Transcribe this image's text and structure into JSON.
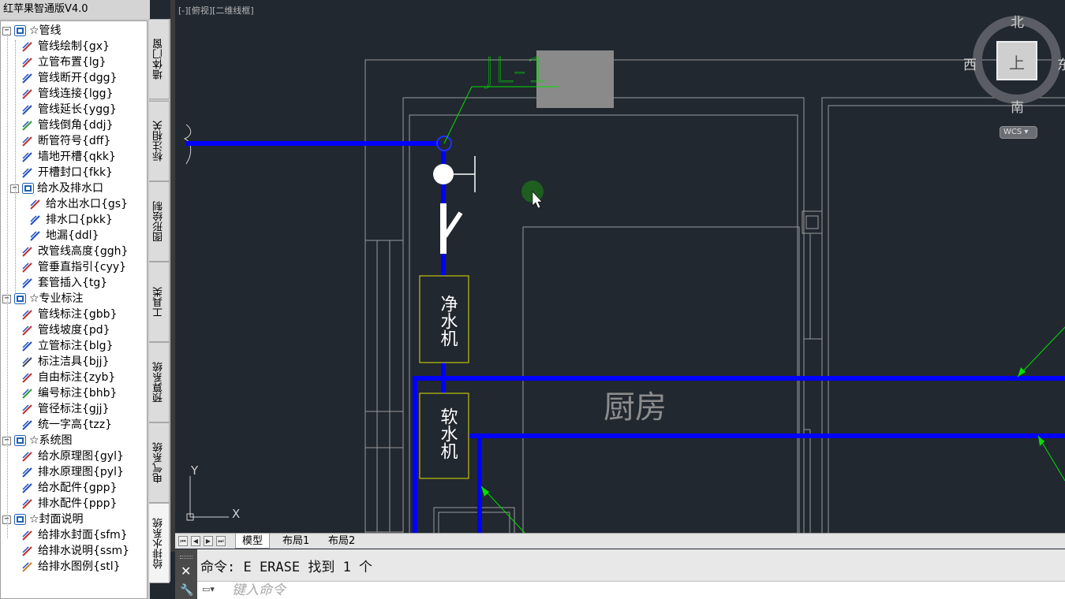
{
  "app": {
    "palette_title": "红苹果智通版V4.0",
    "view_label": "[-][俯视][二维线框]"
  },
  "tree": [
    {
      "level": 0,
      "expand": "−",
      "label": "☆管线",
      "icon": "folder-icon"
    },
    {
      "level": 1,
      "label": "管线绘制{gx}",
      "icon": "draw-pipe-icon",
      "color": "#c03030"
    },
    {
      "level": 1,
      "label": "立管布置{lg}",
      "icon": "riser-icon",
      "color": "#c03030"
    },
    {
      "level": 1,
      "label": "管线断开{dgg}",
      "icon": "break-pipe-icon",
      "color": "#2050c0"
    },
    {
      "level": 1,
      "label": "管线连接{lgg}",
      "icon": "connect-pipe-icon",
      "color": "#c03030"
    },
    {
      "level": 1,
      "label": "管线延长{ygg}",
      "icon": "extend-pipe-icon",
      "color": "#2050c0"
    },
    {
      "level": 1,
      "label": "管线倒角{ddj}",
      "icon": "chamfer-icon",
      "color": "#30a030"
    },
    {
      "level": 1,
      "label": "断管符号{dff}",
      "icon": "break-symbol-icon",
      "color": "#c03030"
    },
    {
      "level": 1,
      "label": "墙地开槽{qkk}",
      "icon": "slot-icon",
      "color": "#2050c0"
    },
    {
      "level": 1,
      "label": "开槽封口{fkk}",
      "icon": "seal-icon",
      "color": "#2050c0"
    },
    {
      "level": 1,
      "expand": "−",
      "label": "给水及排水口",
      "icon": "folder-icon"
    },
    {
      "level": 2,
      "label": "给水出水口{gs}",
      "icon": "water-outlet-icon",
      "color": "#c03030"
    },
    {
      "level": 2,
      "label": "排水口{pkk}",
      "icon": "drain-icon",
      "color": "#2050c0"
    },
    {
      "level": 2,
      "label": "地漏{ddl}",
      "icon": "floor-drain-icon",
      "color": "#2050c0"
    },
    {
      "level": 1,
      "label": "改管线高度{ggh}",
      "icon": "height-icon",
      "color": "#c03030"
    },
    {
      "level": 1,
      "label": "管垂直指引{cyy}",
      "icon": "vertical-lead-icon",
      "color": "#c03030"
    },
    {
      "level": 1,
      "label": "套管插入{tg}",
      "icon": "sleeve-icon",
      "color": "#2050c0"
    },
    {
      "level": 0,
      "expand": "−",
      "label": "☆专业标注",
      "icon": "folder-icon"
    },
    {
      "level": 1,
      "label": "管线标注{gbb}",
      "icon": "pipe-label-icon",
      "color": "#c03030"
    },
    {
      "level": 1,
      "label": "管线坡度{pd}",
      "icon": "slope-icon",
      "color": "#c03030"
    },
    {
      "level": 1,
      "label": "立管标注{blg}",
      "icon": "riser-label-icon",
      "color": "#2050c0"
    },
    {
      "level": 1,
      "label": "标注洁具{bjj}",
      "icon": "fixture-label-icon",
      "color": "#444444"
    },
    {
      "level": 1,
      "label": "自由标注{zyb}",
      "icon": "free-label-icon",
      "color": "#c03030"
    },
    {
      "level": 1,
      "label": "编号标注{bhb}",
      "icon": "number-label-icon",
      "color": "#30a030"
    },
    {
      "level": 1,
      "label": "管径标注{gjj}",
      "icon": "diameter-label-icon",
      "color": "#c03030"
    },
    {
      "level": 1,
      "label": "统一字高{tzz}",
      "icon": "text-height-icon",
      "color": "#2050c0"
    },
    {
      "level": 0,
      "expand": "−",
      "label": "☆系统图",
      "icon": "folder-icon"
    },
    {
      "level": 1,
      "label": "给水原理图{gyl}",
      "icon": "supply-diagram-icon",
      "color": "#c03030"
    },
    {
      "level": 1,
      "label": "排水原理图{pyl}",
      "icon": "drain-diagram-icon",
      "color": "#2050c0"
    },
    {
      "level": 1,
      "label": "给水配件{gpp}",
      "icon": "supply-fitting-icon",
      "color": "#2050c0"
    },
    {
      "level": 1,
      "label": "排水配件{ppp}",
      "icon": "drain-fitting-icon",
      "color": "#c03030"
    },
    {
      "level": 0,
      "expand": "−",
      "label": "☆封面说明",
      "icon": "folder-icon"
    },
    {
      "level": 1,
      "label": "给排水封面{sfm}",
      "icon": "cover-icon",
      "color": "#c03030"
    },
    {
      "level": 1,
      "label": "给排水说明{ssm}",
      "icon": "notes-icon",
      "color": "#c03030"
    },
    {
      "level": 1,
      "label": "给排水图例{stl}",
      "icon": "legend-icon",
      "color": "#d08020"
    }
  ],
  "vtabs": [
    "墙体门窗",
    "标注相关",
    "图形绘制",
    "工具类",
    "预算系统",
    "电气系统",
    "给排水系统"
  ],
  "layout_tabs": [
    "模型",
    "布局1",
    "布局2"
  ],
  "drawing": {
    "riser_label": "JL-1",
    "room_name": "厨房",
    "device1": "净水机",
    "device2": "软水机",
    "ucs_x": "X",
    "ucs_y": "Y"
  },
  "viewcube": {
    "north": "北",
    "south": "南",
    "east": "东",
    "west": "西",
    "top": "上",
    "wcs": "WCS"
  },
  "command": {
    "history": "命令: E ERASE 找到 1 个",
    "placeholder": "键入命令"
  },
  "colors": {
    "pipe": "#0000ff",
    "leader": "#00e000",
    "device_border": "#e0e000",
    "wall": "#9a9a9a",
    "background": "#212830"
  }
}
